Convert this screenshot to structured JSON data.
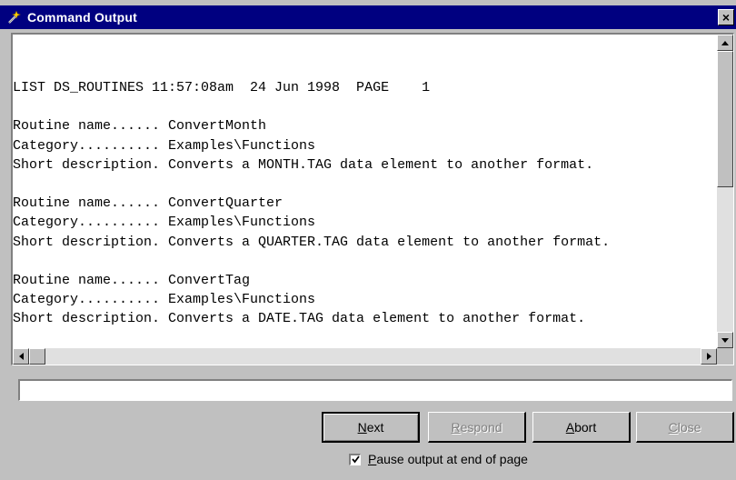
{
  "window": {
    "title": "Command Output",
    "close_glyph": "×"
  },
  "output": {
    "lines": [
      "LIST DS_ROUTINES 11:57:08am  24 Jun 1998  PAGE    1",
      "",
      "Routine name...... ConvertMonth",
      "Category.......... Examples\\Functions",
      "Short description. Converts a MONTH.TAG data element to another format.",
      "",
      "Routine name...... ConvertQuarter",
      "Category.......... Examples\\Functions",
      "Short description. Converts a QUARTER.TAG data element to another format.",
      "",
      "Routine name...... ConvertTag",
      "Category.......... Examples\\Functions",
      "Short description. Converts a DATE.TAG data element to another format."
    ]
  },
  "command_input": {
    "value": ""
  },
  "buttons": {
    "next": {
      "pre": "",
      "key": "N",
      "post": "ext"
    },
    "respond": {
      "pre": "",
      "key": "R",
      "post": "espond"
    },
    "abort": {
      "pre": "",
      "key": "A",
      "post": "bort"
    },
    "close": {
      "pre": "",
      "key": "C",
      "post": "lose"
    }
  },
  "pause_checkbox": {
    "checked": true,
    "key": "P",
    "label_rest": "ause output at end of page"
  },
  "icons": {
    "title": "wand-icon",
    "close": "close-icon",
    "scroll_up": "arrow-up-icon",
    "scroll_down": "arrow-down-icon",
    "scroll_left": "arrow-left-icon",
    "scroll_right": "arrow-right-icon",
    "check": "checkmark-icon"
  },
  "colors": {
    "titlebar": "#000080",
    "face": "#c0c0c0",
    "text_area": "#ffffff"
  }
}
